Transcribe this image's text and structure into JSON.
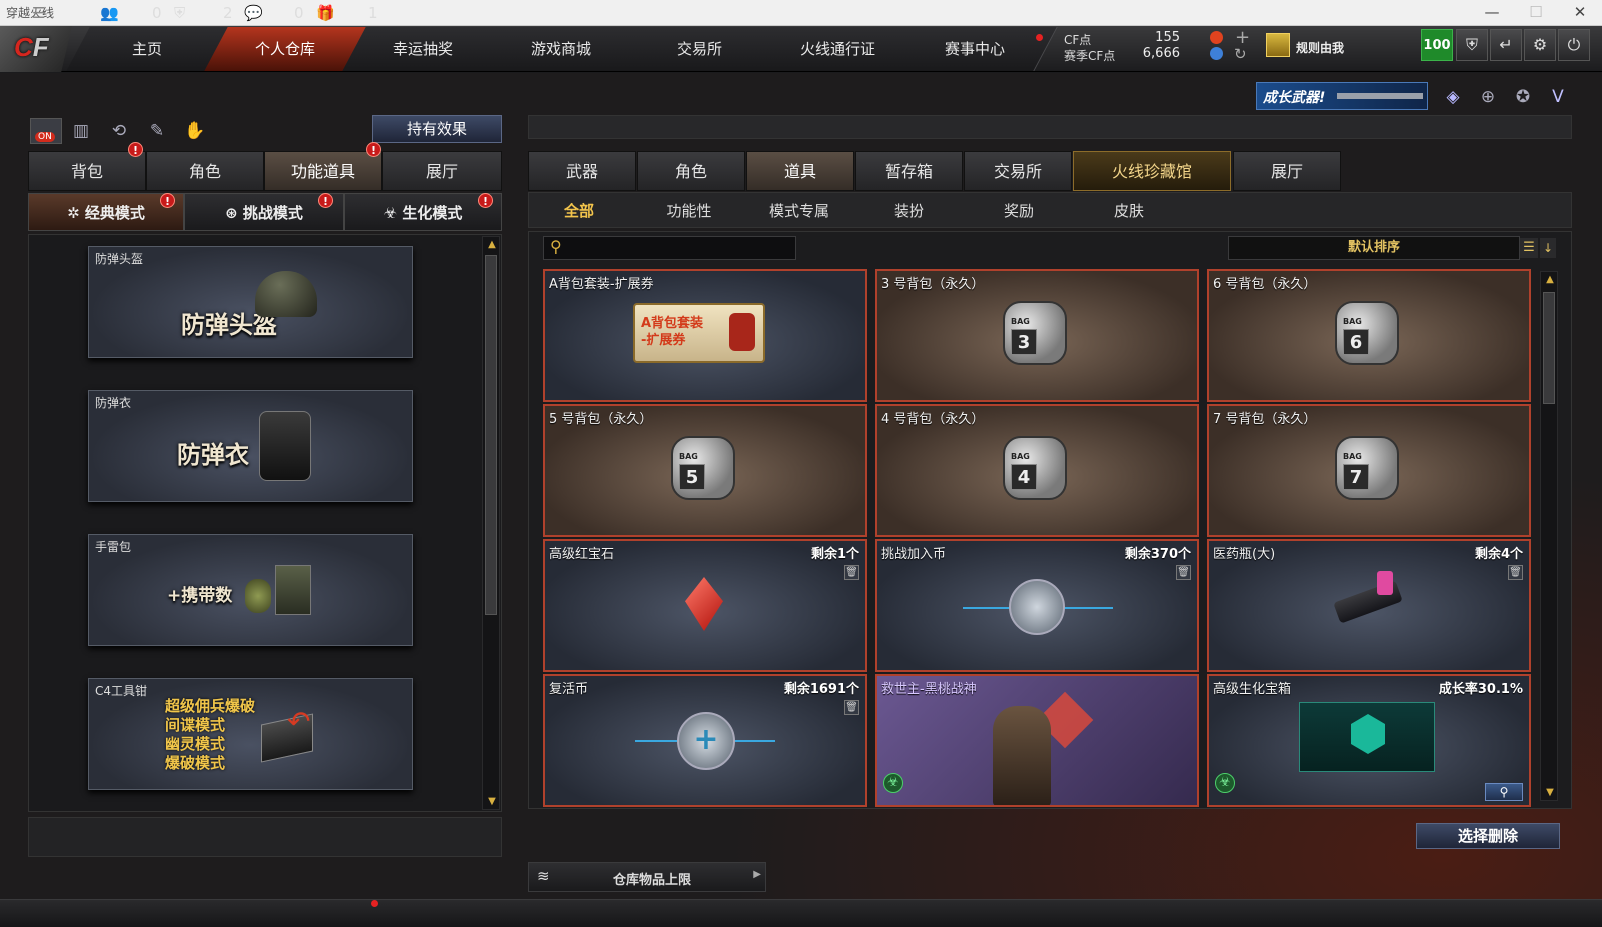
{
  "window": {
    "title": "穿越火线"
  },
  "nav": {
    "tabs": [
      "主页",
      "个人仓库",
      "幸运抽奖",
      "游戏商城",
      "交易所",
      "火线通行证",
      "赛事中心"
    ],
    "active": "个人仓库"
  },
  "currency": {
    "cf_label": "CF点",
    "cf_value": "155",
    "season_label": "赛季CF点",
    "season_value": "6,666"
  },
  "clan": {
    "name": "规则由我"
  },
  "level": "100",
  "promo": {
    "text": "成长武器!"
  },
  "left": {
    "effect_button": "持有效果",
    "tabs": [
      "背包",
      "角色",
      "功能道具",
      "展厅"
    ],
    "active_tab": "功能道具",
    "modes": [
      "经典模式",
      "挑战模式",
      "生化模式"
    ],
    "toggle_label": "ON",
    "items": [
      {
        "title": "防弹头盔",
        "big": "防弹头盔"
      },
      {
        "title": "防弹衣",
        "big": "防弹衣"
      },
      {
        "title": "手雷包",
        "big": "+携带数"
      },
      {
        "title": "C4工具钳",
        "lines": [
          "超级佣兵爆破",
          "间谍模式",
          "幽灵模式",
          "爆破模式"
        ]
      }
    ]
  },
  "right": {
    "tabs": [
      "武器",
      "角色",
      "道具",
      "暂存箱",
      "交易所",
      "火线珍藏馆",
      "展厅"
    ],
    "active_tab": "道具",
    "subtabs": [
      "全部",
      "功能性",
      "模式专属",
      "装扮",
      "奖励",
      "皮肤"
    ],
    "active_subtab": "全部",
    "search_placeholder": "",
    "sort_label": "默认排序",
    "items": [
      {
        "name": "A背包套装-扩展券",
        "count": "",
        "promo": "A背包套装\n-扩展券"
      },
      {
        "name": "3 号背包（永久）",
        "count": "",
        "bag": "3"
      },
      {
        "name": "6 号背包（永久）",
        "count": "",
        "bag": "6"
      },
      {
        "name": "5 号背包（永久）",
        "count": "",
        "bag": "5"
      },
      {
        "name": "4 号背包（永久）",
        "count": "",
        "bag": "4"
      },
      {
        "name": "7 号背包（永久）",
        "count": "",
        "bag": "7"
      },
      {
        "name": "高级红宝石",
        "count": "剩余1个"
      },
      {
        "name": "挑战加入币",
        "count": "剩余370个"
      },
      {
        "name": "医药瓶(大)",
        "count": "剩余4个"
      },
      {
        "name": "复活币",
        "count": "剩余1691个"
      },
      {
        "name": "救世主-黑桃战神",
        "count": ""
      },
      {
        "name": "高级生化宝箱",
        "count": "成长率30.1%"
      }
    ],
    "delete_button": "选择删除",
    "capacity_label": "仓库物品上限"
  },
  "bottom": {
    "count1": "0",
    "count2": "2",
    "count3": "0",
    "count4": "1"
  }
}
